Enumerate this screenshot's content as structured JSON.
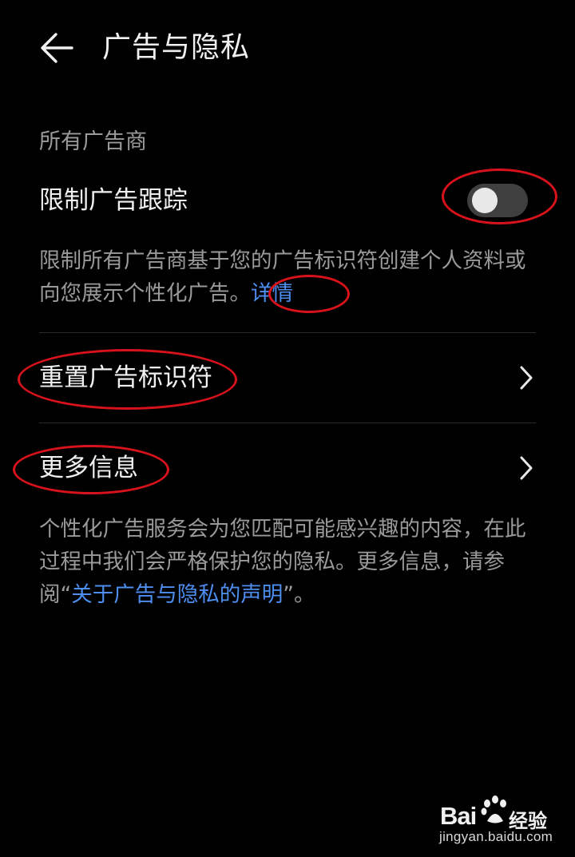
{
  "header": {
    "title": "广告与隐私",
    "back_icon": "arrow-left-icon"
  },
  "section": {
    "title": "所有广告商"
  },
  "limit_tracking": {
    "label": "限制广告跟踪",
    "toggle_on": false,
    "description": "限制所有广告商基于您的广告标识符创建个人资料或向您展示个性化广告。",
    "details_link": "详情"
  },
  "reset_id": {
    "label": "重置广告标识符",
    "chevron_icon": "chevron-right-icon"
  },
  "more_info": {
    "label": "更多信息",
    "chevron_icon": "chevron-right-icon"
  },
  "footer_note": {
    "text_before": "个性化广告服务会为您匹配可能感兴趣的内容，在此过程中我们会严格保护您的隐私。更多信息，请参阅“",
    "link": "关于广告与隐私的声明",
    "text_after": "”。"
  },
  "watermark": {
    "brand": "Bai",
    "brand2": "经验",
    "url": "jingyan.baidu.com"
  },
  "colors": {
    "background": "#000000",
    "link": "#4d8ef0",
    "annotation": "#d8121b",
    "secondary_text": "#9a9a9a"
  }
}
